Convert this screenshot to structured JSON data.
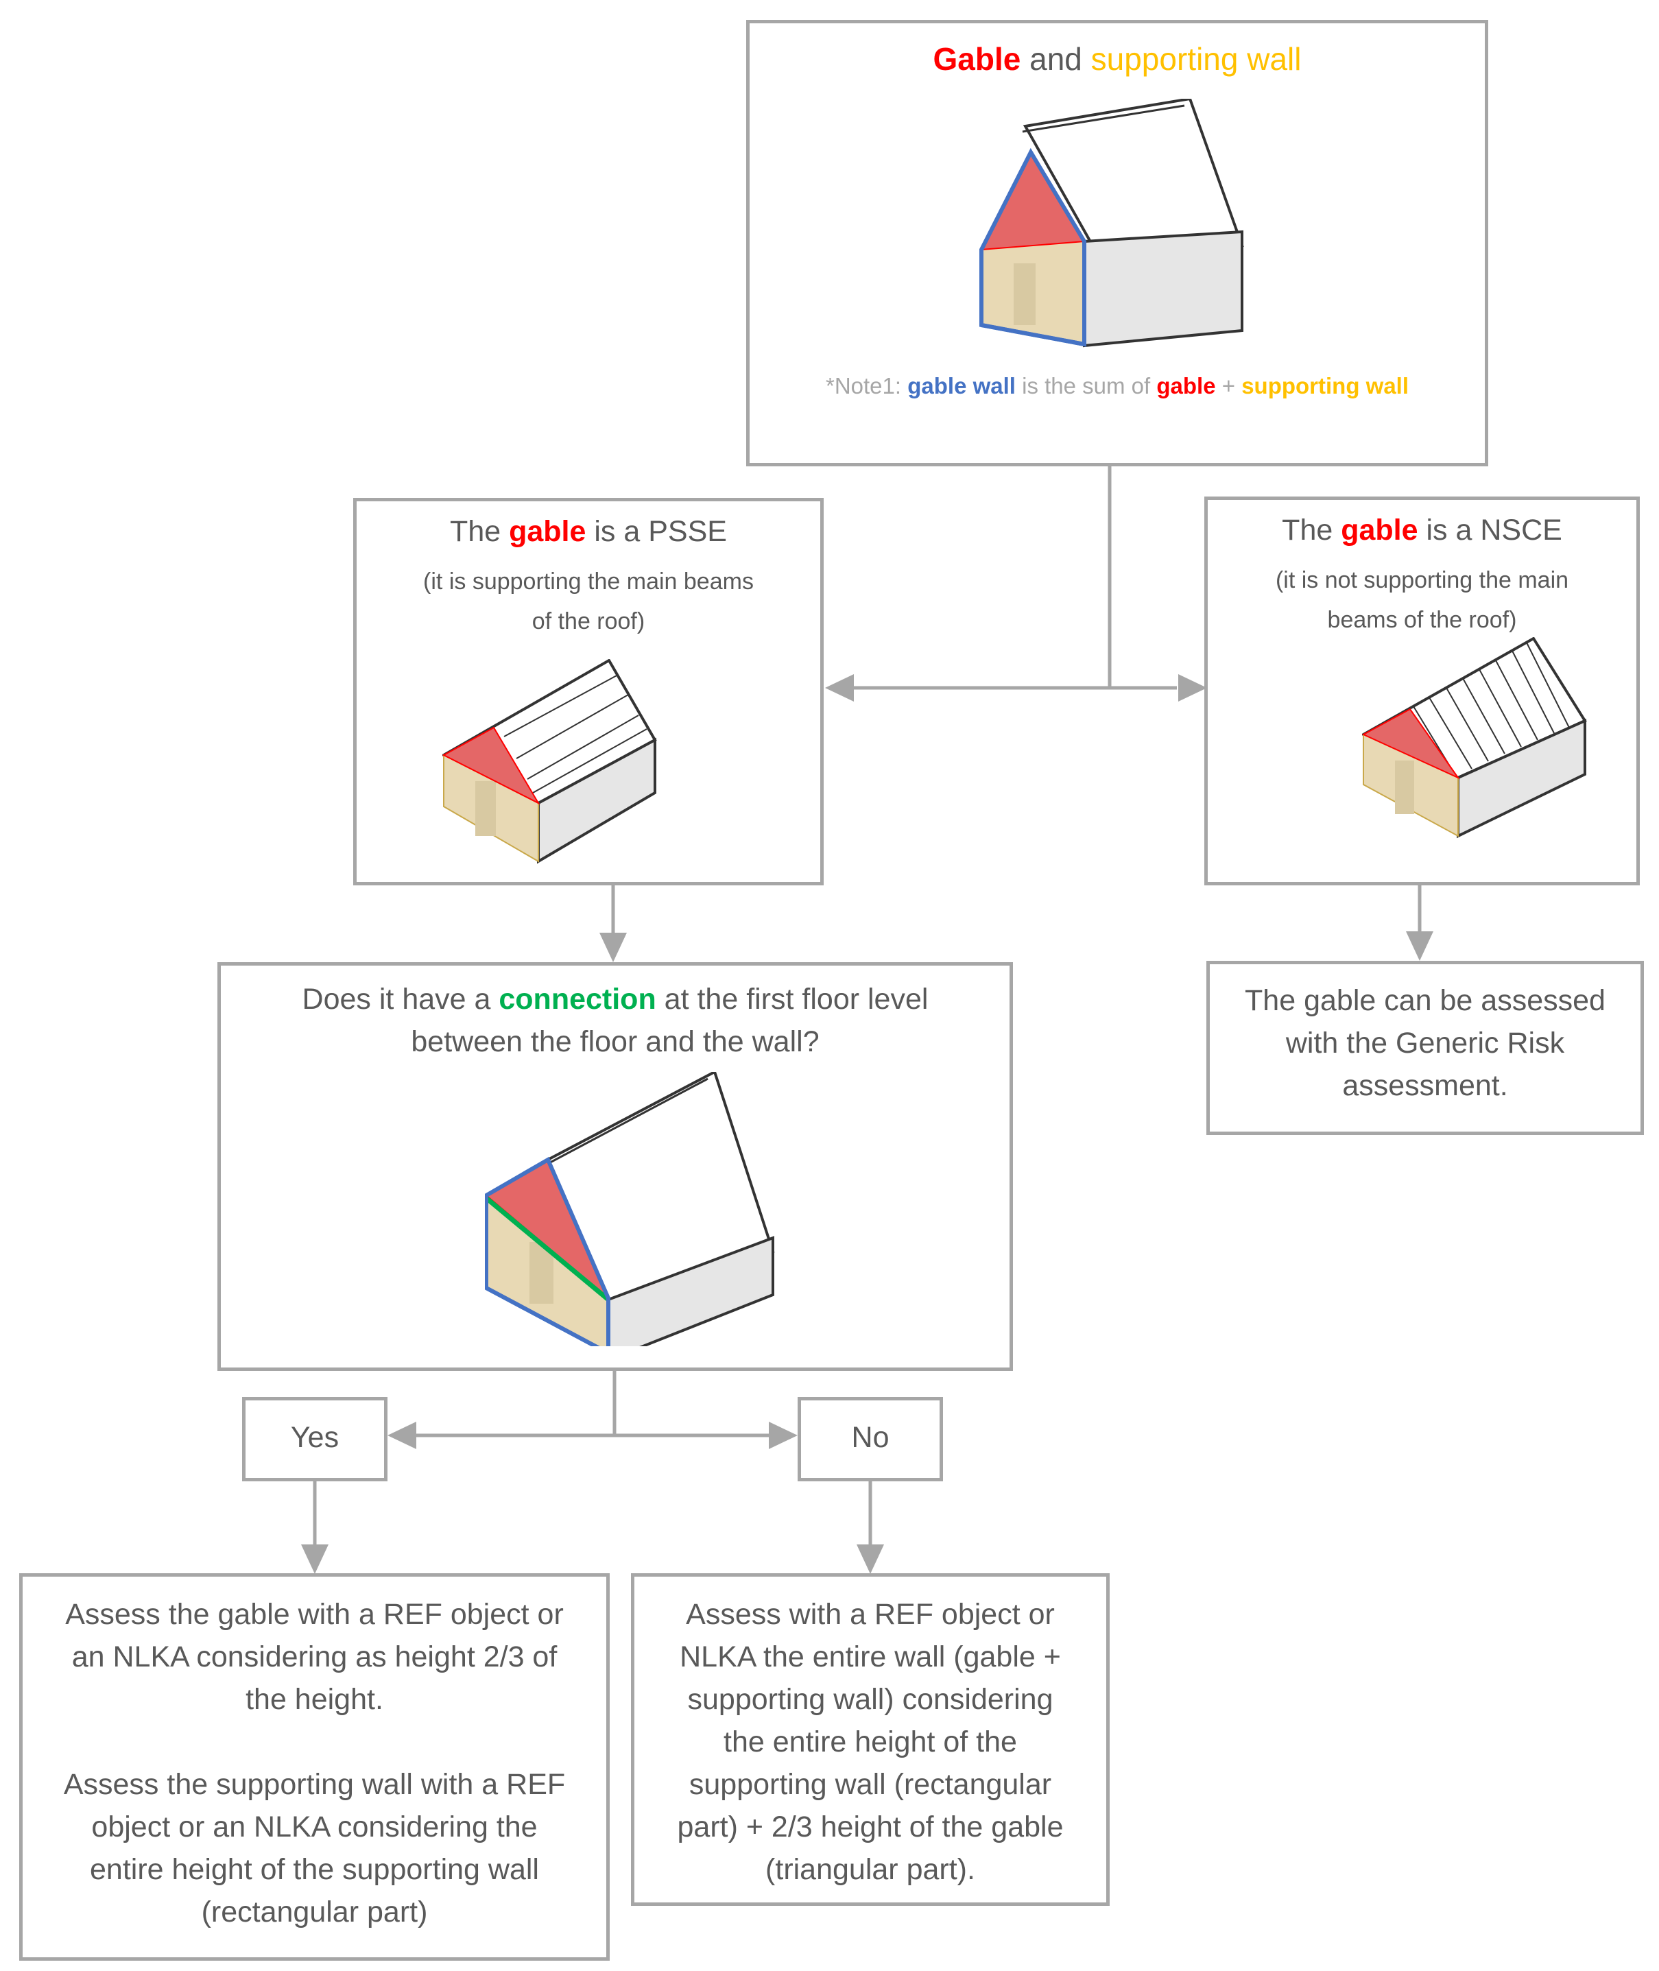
{
  "colors": {
    "box_border": "#a6a6a6",
    "text": "#595959",
    "gable_red": "#ff0000",
    "supporting_wall_yellow": "#ffc000",
    "gable_wall_blue": "#4472c4",
    "connection_green": "#00b050",
    "note_grey": "#a6a6a6",
    "gable_fill": "#e46767",
    "wall_fill": "#e8d9b4",
    "side_fill": "#e6e6e6"
  },
  "top_box": {
    "title_part1": "Gable",
    "title_part2": " and ",
    "title_part3": "supporting wall",
    "note_prefix": "*Note1: ",
    "note_gable_wall": "gable wall",
    "note_mid": " is the sum of ",
    "note_gable": "gable",
    "note_plus": " + ",
    "note_supporting_wall": "supporting wall",
    "illustration": "house-gable-wall-outlined-blue"
  },
  "psse_box": {
    "title_part1": "The ",
    "title_gable": "gable",
    "title_part2": " is a PSSE",
    "subtitle_line1": "(it is supporting the main beams",
    "subtitle_line2": "of the roof)",
    "illustration": "house-longitudinal-beams",
    "roof_beam_count": 4
  },
  "nsce_box": {
    "title_part1": "The ",
    "title_gable": "gable",
    "title_part2": " is a NSCE",
    "subtitle_line1": "(it is not supporting the main",
    "subtitle_line2": "beams of the roof)",
    "illustration": "house-transverse-rafters",
    "roof_rafter_count": 8
  },
  "generic_box": {
    "line1": "The gable can be assessed",
    "line2": "with the Generic Risk",
    "line3": "assessment."
  },
  "connection_box": {
    "line1_part1": "Does it have a ",
    "line1_connection": "connection",
    "line1_part2": " at the first floor level",
    "line2": "between the floor and the wall?",
    "illustration": "house-gable-wall-with-floor-connection"
  },
  "yes_box": {
    "label": "Yes"
  },
  "no_box": {
    "label": "No"
  },
  "yes_result": {
    "lines": [
      "Assess the gable with a REF object or",
      "an NLKA considering as height 2/3 of",
      "the height.",
      "",
      "Assess the supporting wall with a REF",
      "object or an NLKA considering the",
      "entire height of the supporting wall",
      "(rectangular part)"
    ]
  },
  "no_result": {
    "lines": [
      "Assess with a REF object or",
      "NLKA the entire wall (gable +",
      "supporting wall) considering",
      "the entire height of the",
      "supporting wall (rectangular",
      "part) + 2/3 height of the gable",
      "(triangular part)."
    ]
  }
}
